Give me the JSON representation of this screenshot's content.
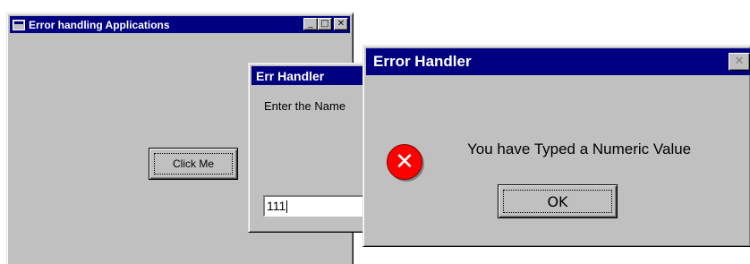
{
  "main_window": {
    "title": "Error handling Applications",
    "minimize_glyph": "_",
    "maximize_glyph": "□",
    "close_glyph": "✕",
    "click_me_label": "Click Me"
  },
  "input_window": {
    "title": "Err Handler",
    "prompt": "Enter the Name",
    "input_value": "111"
  },
  "message_box": {
    "title": "Error Handler",
    "close_glyph": "✕",
    "icon": "error-icon",
    "icon_glyph": "✕",
    "message": "You have Typed a Numeric Value",
    "ok_label": "OK"
  },
  "colors": {
    "title_bar": "#000080",
    "window_face": "#c0c0c0",
    "error_icon": "#ff0000"
  }
}
